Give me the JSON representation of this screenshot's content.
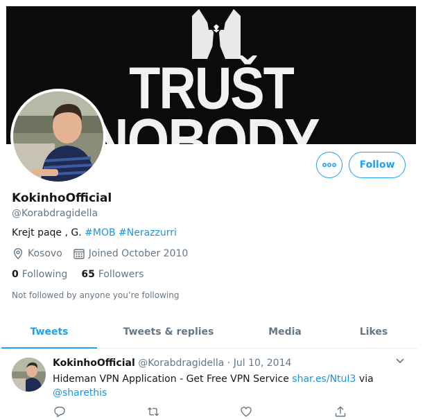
{
  "banner": {
    "line1": "TRUŠT",
    "line2": "NOBODY"
  },
  "profile": {
    "display_name": "KokinhoOfficial",
    "handle": "@Korabdragidella",
    "bio_text": "Krejt paqe , G. ",
    "bio_hashtags": [
      "#MOB",
      "#Nerazzurri"
    ],
    "location": "Kosovo",
    "joined": "Joined October 2010",
    "following_count": "0",
    "following_label": "Following",
    "followers_count": "65",
    "followers_label": "Followers",
    "not_followed_note": "Not followed by anyone you’re following"
  },
  "actions": {
    "more_icon": "more-horizontal-icon",
    "follow_label": "Follow"
  },
  "tabs": [
    {
      "label": "Tweets",
      "active": true
    },
    {
      "label": "Tweets & replies",
      "active": false
    },
    {
      "label": "Media",
      "active": false
    },
    {
      "label": "Likes",
      "active": false
    }
  ],
  "tweet": {
    "author": "KokinhoOfficial",
    "handle": "@Korabdragidella",
    "separator": "·",
    "date": "Jul 10, 2014",
    "text_prefix": "Hideman VPN Application - Get Free VPN Service ",
    "link": "shar.es/NtuI3",
    "text_mid": " via",
    "mention": "@sharethis"
  },
  "colors": {
    "accent": "#1da1f2",
    "link": "#1b95e0",
    "muted": "#657786",
    "text": "#14171a",
    "divider": "#e6ecf0"
  }
}
